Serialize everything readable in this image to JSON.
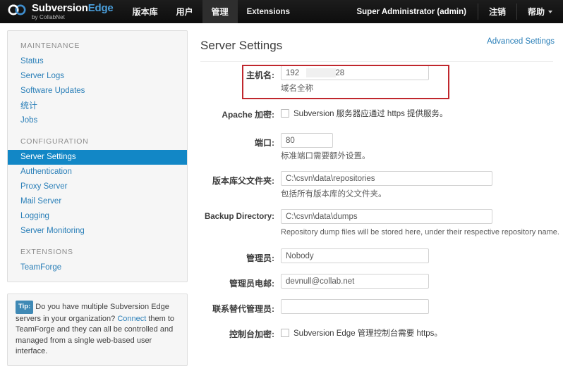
{
  "brand": {
    "logo_icon": "interlocking-rings-icon",
    "name_first": "Subversion",
    "name_second": "Edge",
    "tagline": "by CollabNet"
  },
  "topnav": {
    "items": [
      {
        "label": "版本库",
        "cjk": true,
        "active": false
      },
      {
        "label": "用户",
        "cjk": true,
        "active": false
      },
      {
        "label": "管理",
        "cjk": true,
        "active": true
      },
      {
        "label": "Extensions",
        "cjk": false,
        "active": false
      }
    ],
    "user": "Super Administrator (admin)",
    "logout": "注销",
    "help": "帮助",
    "help_caret_icon": "chevron-down-icon"
  },
  "sidebar": {
    "groups": [
      {
        "heading": "MAINTENANCE",
        "items": [
          {
            "label": "Status",
            "cjk": false,
            "active": false
          },
          {
            "label": "Server Logs",
            "cjk": false,
            "active": false
          },
          {
            "label": "Software Updates",
            "cjk": false,
            "active": false
          },
          {
            "label": "统计",
            "cjk": true,
            "active": false
          },
          {
            "label": "Jobs",
            "cjk": false,
            "active": false
          }
        ]
      },
      {
        "heading": "CONFIGURATION",
        "items": [
          {
            "label": "Server Settings",
            "cjk": false,
            "active": true
          },
          {
            "label": "Authentication",
            "cjk": false,
            "active": false
          },
          {
            "label": "Proxy Server",
            "cjk": false,
            "active": false
          },
          {
            "label": "Mail Server",
            "cjk": false,
            "active": false
          },
          {
            "label": "Logging",
            "cjk": false,
            "active": false
          },
          {
            "label": "Server Monitoring",
            "cjk": false,
            "active": false
          }
        ]
      },
      {
        "heading": "EXTENSIONS",
        "items": [
          {
            "label": "TeamForge",
            "cjk": false,
            "active": false
          }
        ]
      }
    ],
    "tip": {
      "badge": "Tip:",
      "text_before": "Do you have multiple Subversion Edge servers in your organization?",
      "link": "Connect",
      "text_after": "them to TeamForge and they can all be controlled and managed from a single web-based user interface."
    }
  },
  "main": {
    "title": "Server Settings",
    "advanced_link": "Advanced Settings",
    "fields": {
      "hostname": {
        "label": "主机名:",
        "value": "192              128",
        "hint": "域名全称",
        "redacted": true,
        "highlighted": true
      },
      "apache_encryption": {
        "label": "Apache 加密:",
        "checkbox_label": "Subversion 服务器应通过 https 提供服务。",
        "checked": false
      },
      "port": {
        "label": "端口:",
        "value": "80",
        "hint": "标准端口需要额外设置。"
      },
      "repo_parent": {
        "label": "版本库父文件夹:",
        "value": "C:\\csvn\\data\\repositories",
        "hint": "包括所有版本库的父文件夹。"
      },
      "backup_dir": {
        "label": "Backup Directory:",
        "value": "C:\\csvn\\data\\dumps",
        "hint": "Repository dump files will be stored here, under their respective repository name."
      },
      "admin": {
        "label": "管理员:",
        "value": "Nobody"
      },
      "admin_email": {
        "label": "管理员电邮:",
        "value": "devnull@collab.net"
      },
      "alt_admin": {
        "label": "联系替代管理员:",
        "value": ""
      },
      "console_encryption": {
        "label": "控制台加密:",
        "checkbox_label": "Subversion Edge 管理控制台需要 https。",
        "checked": false
      }
    }
  },
  "colors": {
    "topbar": "#151515",
    "accent_blue": "#1287c6",
    "link_blue": "#2a7fb8",
    "brand_blue": "#4a9fdc",
    "annotation_red": "#c0272d",
    "panel_bg": "#f6f6f6"
  }
}
